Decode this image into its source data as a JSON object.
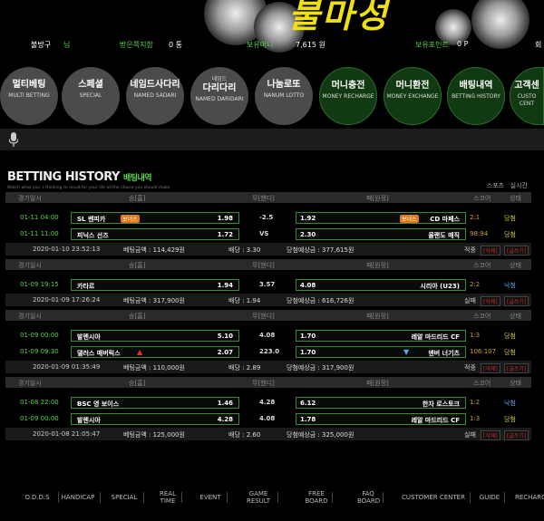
{
  "info": {
    "user": "불방구",
    "user_suffix": "님",
    "money_label": "보유머니",
    "money": "7,615 원",
    "point_label": "보유포인트",
    "point": "0 P",
    "side_label": "회",
    "noti_label": "받은쪽지함",
    "noti": "0 통"
  },
  "menu": [
    {
      "k": "멀티베팅",
      "e": "MULTI BETTING"
    },
    {
      "k": "스페셜",
      "e": "SPECIAL"
    },
    {
      "k": "네임드사다리",
      "e": "NAMED SADARI"
    },
    {
      "k": "다리다리",
      "e": "NAMED DARIDARI",
      "pre": "네임드"
    },
    {
      "k": "나눔로또",
      "e": "NANUM LOTTO"
    },
    {
      "k": "머니충전",
      "e": "MONEY RECHARGE"
    },
    {
      "k": "머니환전",
      "e": "MONEY EXCHANGE"
    },
    {
      "k": "배팅내역",
      "e": "BETTING HISTORY"
    },
    {
      "k": "고객센",
      "e": "CUSTO CENT"
    }
  ],
  "title": "BETTING HISTORY",
  "title_kr": "배팅내역",
  "subtitle": "Watch what you`s thinking to result for your life all the choice you should make",
  "tabs": {
    "a": "스포츠",
    "b": "실시간"
  },
  "columns": {
    "date": "경기일시",
    "home": "승[홈]",
    "mid": "무[핸디]",
    "away": "패[원정]",
    "score": "스코어",
    "status": "상태"
  },
  "groups": [
    {
      "games": [
        {
          "date": "01-11 04:00",
          "home": "SL 벤피카",
          "home_bonus": "보너스",
          "home_odd": "1.98",
          "mid": "-2.5",
          "away_odd": "1.92",
          "away": "CD 마페스",
          "away_bonus": "보너스",
          "score": "2:1",
          "status": "당첨"
        },
        {
          "date": "01-11 11:00",
          "home": "피닉스 선즈",
          "home_odd": "1.72",
          "mid": "VS",
          "away_odd": "2.30",
          "away": "올랜도 매직",
          "score": "98:94",
          "status": "당첨"
        }
      ],
      "summary": {
        "time": "2020-01-10 23:52:13",
        "bet": "베팅금액 : 114,429원",
        "odds": "배당 : 3.30",
        "win": "당첨예상금 : 377,615원",
        "result": "적중",
        "del": "[삭제]",
        "write": "[글쓰기]"
      }
    },
    {
      "games": [
        {
          "date": "01-09 19:15",
          "home": "카타르",
          "home_odd": "1.94",
          "mid": "3.57",
          "away_odd": "4.08",
          "away": "시리아 (U23)",
          "score": "2:2",
          "status": "낙첨"
        }
      ],
      "summary": {
        "time": "2020-01-09 17:26:24",
        "bet": "베팅금액 : 317,900원",
        "odds": "배당 : 1.94",
        "win": "당첨예상금 : 616,726원",
        "result": "실패",
        "del": "[삭제]",
        "write": "[글쓰기]"
      }
    },
    {
      "games": [
        {
          "date": "01-09 00:00",
          "home": "발렌시아",
          "home_odd": "5.10",
          "mid": "4.08",
          "away_odd": "1.70",
          "away": "레알 마드리드 CF",
          "score": "1:3",
          "status": "당첨"
        },
        {
          "date": "01-09 09:30",
          "home": "댈러스 매버릭스",
          "home_odd": "2.07",
          "mid": "223.0",
          "away_odd": "1.70",
          "away": "덴버 너기츠",
          "score": "106:107",
          "status": "당첨"
        }
      ],
      "summary": {
        "time": "2020-01-09 01:35:49",
        "bet": "베팅금액 : 110,000원",
        "odds": "배당 : 2.89",
        "win": "당첨예상금 : 317,900원",
        "result": "적중",
        "del": "[삭제]",
        "write": "[글쓰기]"
      }
    },
    {
      "games": [
        {
          "date": "01-08 22:00",
          "home": "BSC 영 보이스",
          "home_odd": "1.46",
          "mid": "4.28",
          "away_odd": "6.12",
          "away": "한자 로스토크",
          "score": "1:2",
          "status": "낙첨"
        },
        {
          "date": "01-09 00:00",
          "home": "발렌시아",
          "home_odd": "4.28",
          "mid": "4.08",
          "away_odd": "1.78",
          "away": "레알 마드리드 CF",
          "score": "1:3",
          "status": "당첨"
        }
      ],
      "summary": {
        "time": "2020-01-08 21:05:47",
        "bet": "베팅금액 : 125,000원",
        "odds": "배당 : 2.60",
        "win": "당첨예상금 : 325,000원",
        "result": "실패",
        "del": "[삭제]",
        "write": "[글쓰기]"
      }
    }
  ],
  "footer": [
    "O.D.D.S",
    "HANDICAP",
    "SPECIAL",
    "REAL TIME",
    "EVENT",
    "GAME RESULT",
    "FREE BOARD",
    "FAQ BOARD",
    "CUSTOMER CENTER",
    "GUIDE",
    "RECHARGE"
  ],
  "colors": {
    "win": "#d6d23a",
    "lose": "#5aa8f0",
    "accent": "#59d64a",
    "red": "#c03030"
  }
}
